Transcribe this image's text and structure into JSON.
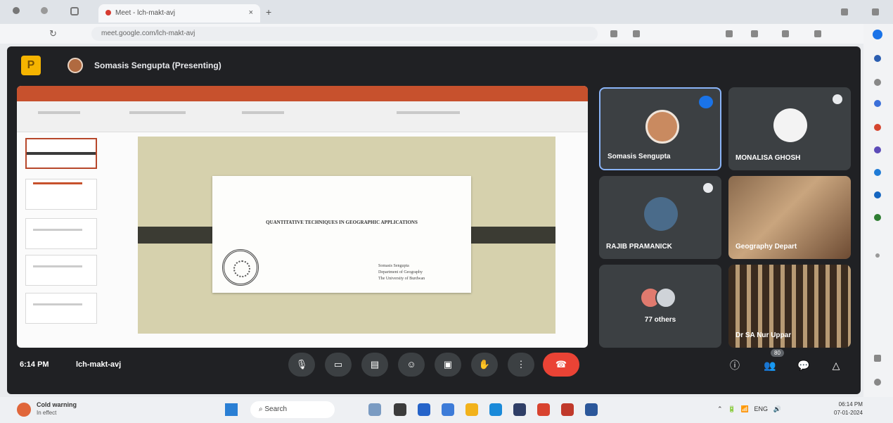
{
  "browser": {
    "tab_title": "Meet - lch-makt-avj",
    "new_tab": "+",
    "close_tab": "×",
    "address": "meet.google.com/lch-makt-avj"
  },
  "meet": {
    "presenting_icon": "P",
    "presenter_title": "Somasis Sengupta (Presenting)",
    "slide": {
      "title": "QUANTITATIVE TECHNIQUES IN GEOGRAPHIC APPLICATIONS",
      "author_lines": [
        "Somasis Sengupta",
        "Department of Geography",
        "The University of Burdwan"
      ]
    },
    "participants": [
      {
        "name": "Somasis Sengupta"
      },
      {
        "name": "MONALISA GHOSH"
      },
      {
        "name": "RAJIB PRAMANICK"
      },
      {
        "name": "Geography Depart"
      },
      {
        "name": "77 others"
      },
      {
        "name": "Dr SA Nur Uppar"
      }
    ],
    "time": "6:14 PM",
    "meeting_code": "lch-makt-avj",
    "people_badge": "80",
    "controls": {
      "mic": "🎙",
      "camera": "▭",
      "captions": "▤",
      "emoji": "☺",
      "present": "▣",
      "raise_hand": "✋",
      "more": "⋮",
      "end": "☎",
      "info": "ⓘ",
      "people": "👥",
      "chat": "💬",
      "activities": "△"
    }
  },
  "taskbar": {
    "weather_line1": "Cold warning",
    "weather_line2": "In effect",
    "search_label": "Search",
    "tray_text": "ENG",
    "clock_time": "06:14 PM",
    "clock_date": "07-01-2024"
  }
}
